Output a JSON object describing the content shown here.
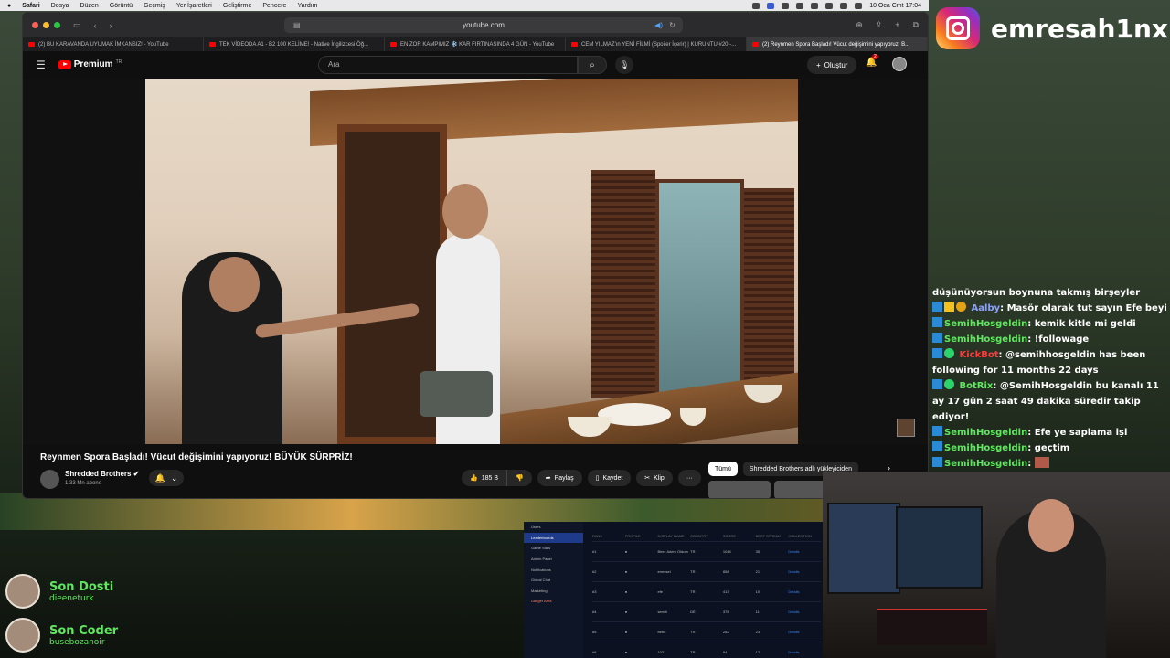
{
  "menubar": {
    "app": "Safari",
    "items": [
      "Dosya",
      "Düzen",
      "Görüntü",
      "Geçmiş",
      "Yer İşaretleri",
      "Geliştirme",
      "Pencere",
      "Yardım"
    ],
    "datetime": "10 Oca Cmt 17:04"
  },
  "browser": {
    "url": "youtube.com",
    "tabs": [
      "(2) BU KARAVANDA UYUMAK İMKANSIZ! - YouTube",
      "TEK VİDEODA A1 - B2 100 KELİME! - Native İngilizcesi Öğ...",
      "EN ZOR KAMPIMIZ ❄️ KAR FIRTINASINDA 4 GÜN - YouTube",
      "CEM YILMAZ'ın YENİ FİLMİ (Spoiler İçerir) | KURUNTU #20 -...",
      "(2) Reynmen Spora Başladı! Vücut değişimini yapıyoruz! B..."
    ]
  },
  "youtube": {
    "logo": "Premium",
    "logo_sup": "TR",
    "search_placeholder": "Ara",
    "create_label": "Oluştur",
    "notif_count": "2",
    "video_title": "Reynmen Spora Başladı! Vücut değişimini yapıyoruz! BÜYÜK SÜRPRİZ!",
    "channel": "Shredded Brothers",
    "subscribers": "1,33 Mn abone",
    "likes": "185 B",
    "share": "Paylaş",
    "save": "Kaydet",
    "clip": "Klip",
    "more": "···",
    "chips": [
      "Tümü",
      "Shredded Brothers adlı yükleyiciden"
    ]
  },
  "overlay": {
    "instagram": "emresah1nx",
    "chat": [
      {
        "user": "",
        "msg": "düşünüyorsun boynuna takmış birşeyler",
        "color": "#ffffff"
      },
      {
        "user": "Aalby",
        "msg": "Masör olarak tut sayın Efe beyi",
        "color": "#8aa0ff"
      },
      {
        "user": "SemihHosgeldin",
        "msg": "kemik kitle mi geldi",
        "color": "#5fe85f"
      },
      {
        "user": "SemihHosgeldin",
        "msg": "!followage",
        "color": "#5fe85f"
      },
      {
        "user": "KickBot",
        "msg": "@semihhosgeldin has been following for 11 months 22 days",
        "color": "#ff3b3b"
      },
      {
        "user": "BotRix",
        "msg": "@SemihHosgeldin bu kanalı 11 ay 17 gün 2 saat 49 dakika süredir takip ediyor!",
        "color": "#5fe85f"
      },
      {
        "user": "SemihHosgeldin",
        "msg": "Efe ye saplama işi",
        "color": "#5fe85f"
      },
      {
        "user": "SemihHosgeldin",
        "msg": "geçtim",
        "color": "#5fe85f"
      },
      {
        "user": "SemihHosgeldin",
        "msg": "",
        "color": "#5fe85f"
      }
    ],
    "last_follow_label": "Son Dosti",
    "last_follow_name": "dieeneturk",
    "last_sub_label": "Son Coder",
    "last_sub_name": "busebozanoir"
  },
  "dashboard": {
    "menu": [
      "Users",
      "Leaderboards",
      "Game Stats",
      "Admin Panel",
      "Notifications",
      "Global Chat",
      "Marketing",
      "Danger Area"
    ],
    "headers": [
      "RANK",
      "PROFILE",
      "DISPLAY NAME",
      "COUNTRY",
      "SCORE",
      "BEST STREAK",
      "COLLECTION"
    ],
    "rows": [
      [
        "#1",
        "",
        "Birez Adem Oldum",
        "TR",
        "1044",
        "35",
        "Details"
      ],
      [
        "#2",
        "",
        "emresel",
        "TR",
        "858",
        "21",
        "Details"
      ],
      [
        "#3",
        "",
        "efe",
        "TR",
        "413",
        "10",
        "Details"
      ],
      [
        "#4",
        "",
        "semih",
        "DE",
        "378",
        "11",
        "Details"
      ],
      [
        "#5",
        "",
        "bebo",
        "TR",
        "282",
        "23",
        "Details"
      ],
      [
        "#6",
        "",
        "1021",
        "TR",
        "94",
        "12",
        "Details"
      ]
    ]
  }
}
